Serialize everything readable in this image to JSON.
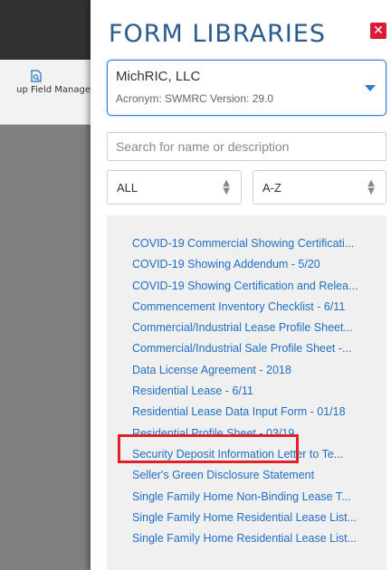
{
  "backdrop": {
    "toolbar_item_label": "up Field Manage",
    "toolbar_item_icon": "document-search-icon"
  },
  "panel": {
    "title": "FORM LIBRARIES",
    "close_icon": "close-icon",
    "close_color": "#d91c38"
  },
  "library": {
    "name": "MichRIC, LLC",
    "meta": "Acronym: SWMRC   Version: 29.0",
    "caret_icon": "chevron-down-icon"
  },
  "search": {
    "placeholder": "Search for name or description",
    "value": ""
  },
  "filters": {
    "type_value": "ALL",
    "sort_value": "A-Z",
    "arrows_icon": "up-down-arrows-icon"
  },
  "forms": [
    {
      "label": "COVID-19 Commercial Showing Certificati..."
    },
    {
      "label": "COVID-19 Showing Addendum - 5/20"
    },
    {
      "label": "COVID-19 Showing Certification and Relea..."
    },
    {
      "label": "Commencement Inventory Checklist - 6/11"
    },
    {
      "label": "Commercial/Industrial Lease Profile Sheet..."
    },
    {
      "label": "Commercial/Industrial Sale Profile Sheet -..."
    },
    {
      "label": "Data License Agreement - 2018"
    },
    {
      "label": "Residential Lease - 6/11"
    },
    {
      "label": "Residential Lease Data Input Form - 01/18"
    },
    {
      "label": "Residential Profile Sheet - 03/19"
    },
    {
      "label": "Security Deposit Information Letter to Te..."
    },
    {
      "label": "Seller's Green Disclosure Statement"
    },
    {
      "label": "Single Family Home Non-Binding Lease T..."
    },
    {
      "label": "Single Family Home Residential Lease List..."
    },
    {
      "label": "Single Family Home Residential Lease List..."
    }
  ],
  "colors": {
    "title": "#2a5b8f",
    "link": "#1f6fc4",
    "highlight": "#e0202a",
    "accent": "#2f7ad0"
  }
}
